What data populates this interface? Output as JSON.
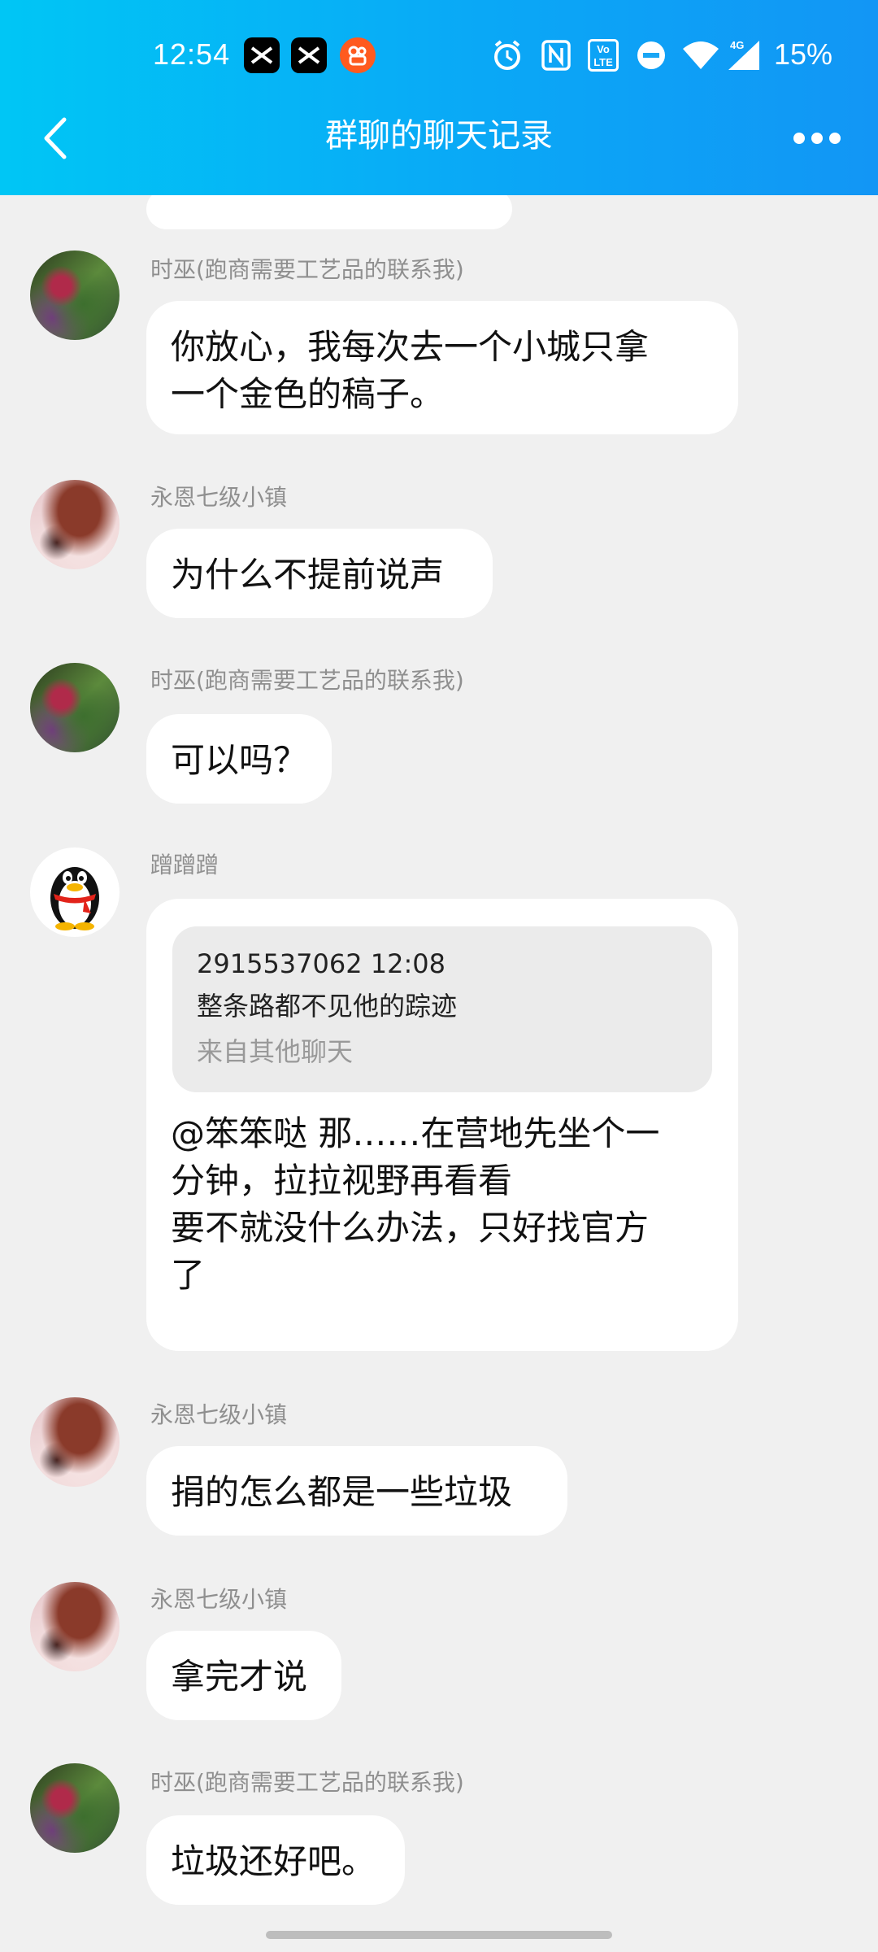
{
  "status_bar": {
    "time": "12:54",
    "battery": "15%",
    "network": "4G",
    "volte": "VoLTE",
    "icons": [
      "capcut-icon",
      "capcut-icon",
      "kuaishou-icon",
      "alarm-icon",
      "nfc-icon",
      "volte-icon",
      "dnd-icon",
      "wifi-icon",
      "signal-icon"
    ]
  },
  "header": {
    "title": "群聊的聊天记录"
  },
  "messages": [
    {
      "sender": "时巫(跑商需要工艺品的联系我)",
      "avatar": "green-swirl-avatar",
      "text": "你放心，我每次去一个小城只拿\n一个金色的稿子。"
    },
    {
      "sender": "永恩七级小镇",
      "avatar": "anime-avatar",
      "text": "为什么不提前说声"
    },
    {
      "sender": "时巫(跑商需要工艺品的联系我)",
      "avatar": "green-swirl-avatar",
      "text": "可以吗？"
    },
    {
      "sender": "蹭蹭蹭",
      "avatar": "qq-penguin-avatar",
      "quote": {
        "meta": "2915537062 12:08",
        "text": "整条路都不见他的踪迹",
        "source": "来自其他聊天"
      },
      "text": "@笨笨哒 那……在营地先坐个一\n分钟，拉拉视野再看看\n要不就没什么办法，只好找官方\n了"
    },
    {
      "sender": "永恩七级小镇",
      "avatar": "anime-avatar",
      "text": "捐的怎么都是一些垃圾"
    },
    {
      "sender": "永恩七级小镇",
      "avatar": "anime-avatar",
      "text": "拿完才说"
    },
    {
      "sender": "时巫(跑商需要工艺品的联系我)",
      "avatar": "green-swirl-avatar",
      "text": "垃圾还好吧。"
    }
  ]
}
